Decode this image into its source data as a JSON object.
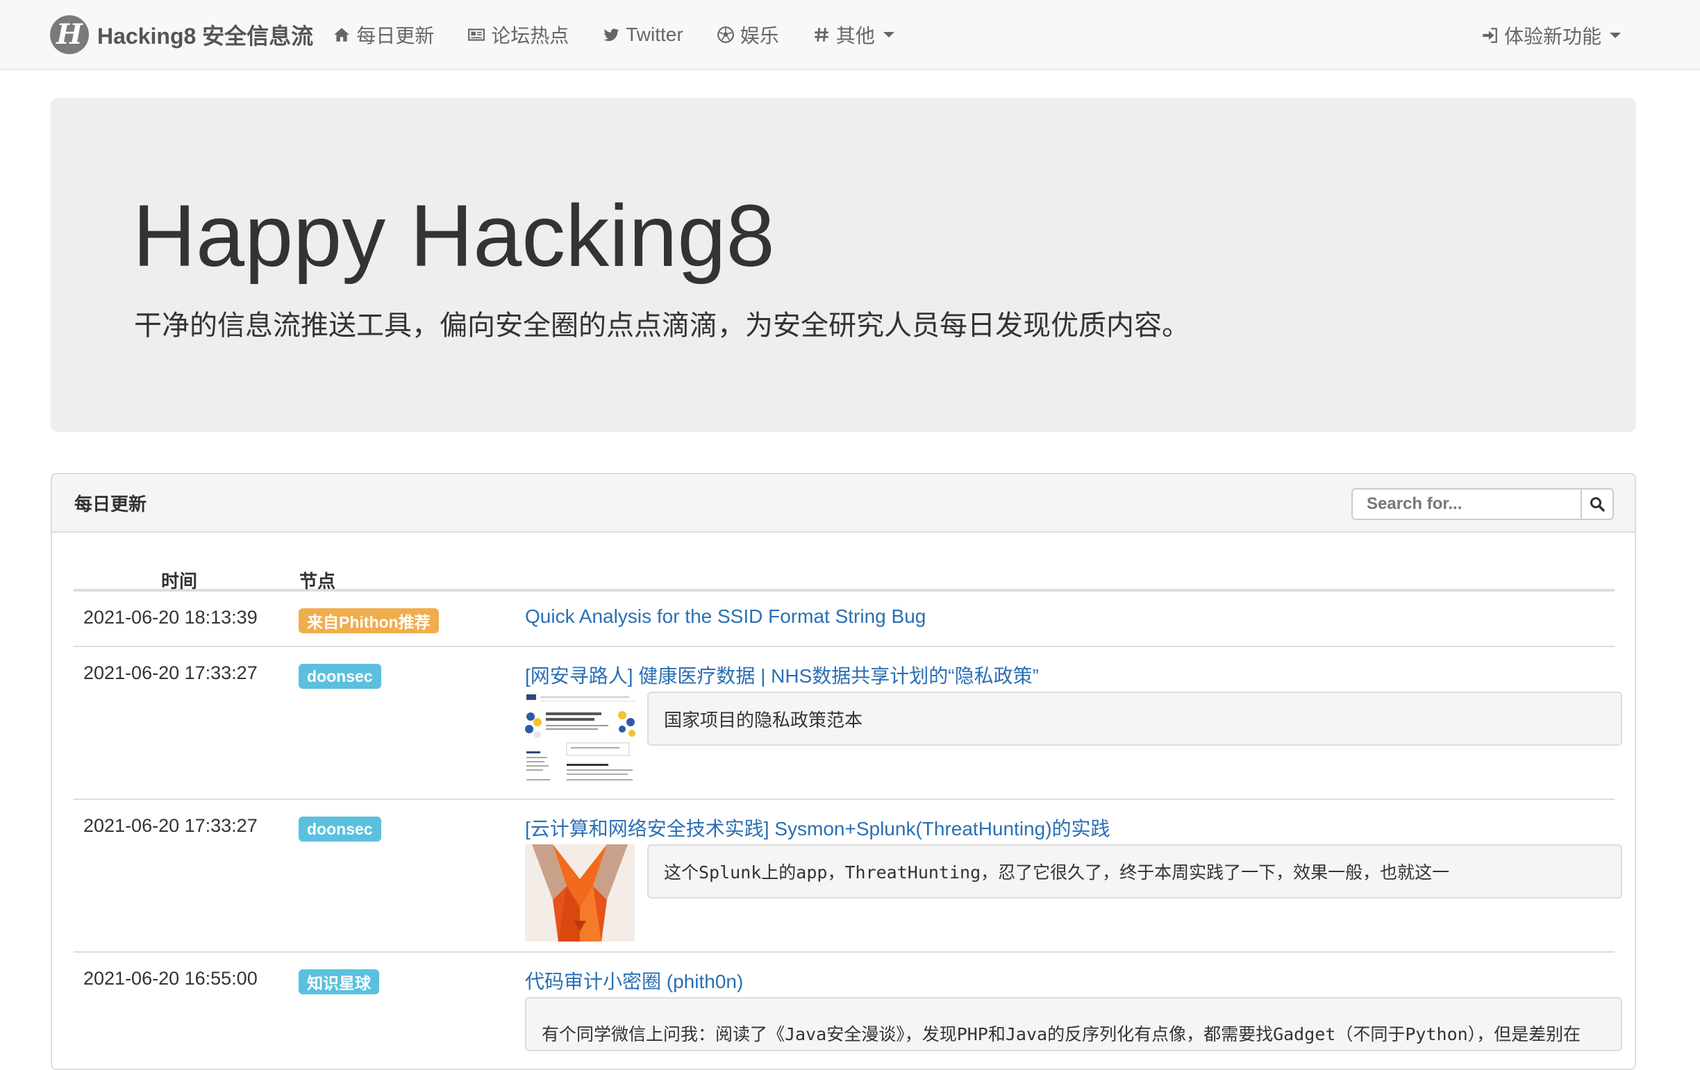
{
  "navbar": {
    "brand_logo": "H",
    "brand_text": "Hacking8 安全信息流",
    "items": [
      {
        "label": "每日更新",
        "icon": "home-icon"
      },
      {
        "label": "论坛热点",
        "icon": "newspaper-icon"
      },
      {
        "label": "Twitter",
        "icon": "twitter-icon"
      },
      {
        "label": "娱乐",
        "icon": "soccer-ball-icon"
      },
      {
        "label": "其他",
        "icon": "hashtag-icon"
      }
    ],
    "right_item": {
      "label": "体验新功能",
      "icon": "sign-in-icon"
    }
  },
  "jumbotron": {
    "title": "Happy Hacking8",
    "subtitle": "干净的信息流推送工具，偏向安全圈的点点滴滴，为安全研究人员每日发现优质内容。"
  },
  "panel": {
    "title": "每日更新",
    "search_placeholder": "Search for...",
    "columns": {
      "time": "时间",
      "node": "节点"
    },
    "rows": [
      {
        "time": "2021-06-20 18:13:39",
        "badge": "来自Phithon推荐",
        "badge_color": "#f0ad4e",
        "title": "Quick Analysis for the SSID Format String Bug",
        "summary": ""
      },
      {
        "time": "2021-06-20 17:33:27",
        "badge": "doonsec",
        "badge_color": "#5bc0de",
        "title": "[网安寻路人] 健康医疗数据 | NHS数据共享计划的“隐私政策”",
        "summary": "国家项目的隐私政策范本"
      },
      {
        "time": "2021-06-20 17:33:27",
        "badge": "doonsec",
        "badge_color": "#5bc0de",
        "title": "[云计算和网络安全技术实践] Sysmon+Splunk(ThreatHunting)的实践",
        "summary": "这个Splunk上的app，ThreatHunting，忍了它很久了，终于本周实践了一下，效果一般，也就这一"
      },
      {
        "time": "2021-06-20 16:55:00",
        "badge": "知识星球",
        "badge_color": "#5bc0de",
        "title": "代码审计小密圈 (phith0n)",
        "summary": "有个同学微信上问我：阅读了《Java安全漫谈》，发现PHP和Java的反序列化有点像，都需要找Gadget（不同于Python），但是差别在"
      }
    ]
  }
}
